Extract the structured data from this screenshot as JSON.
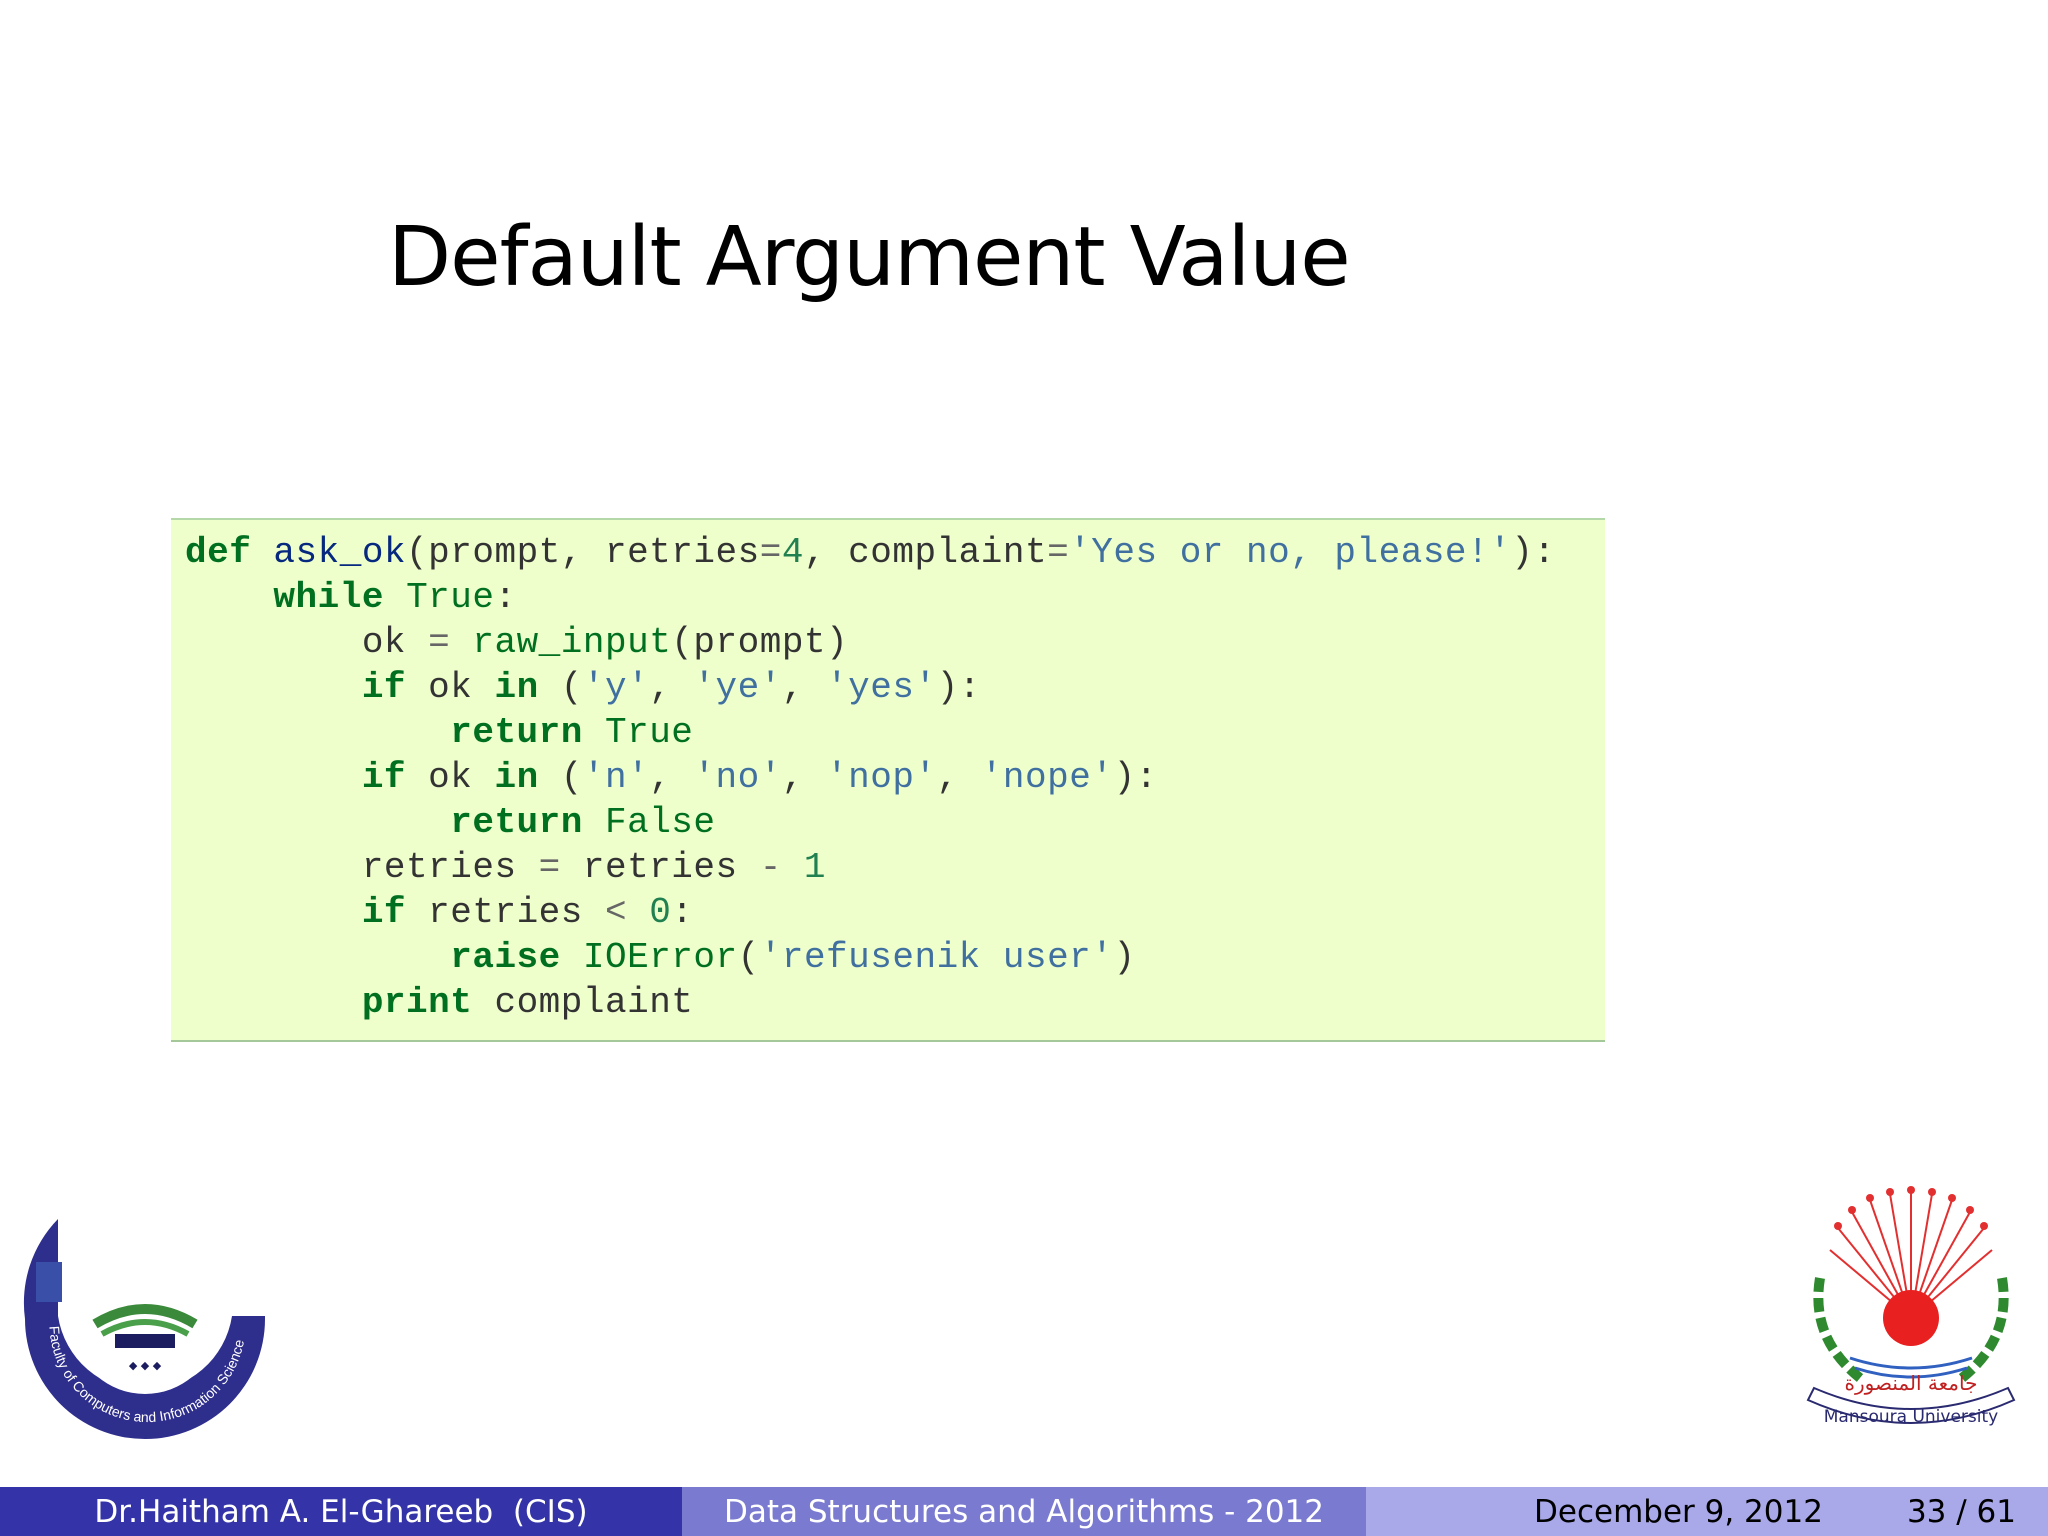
{
  "slide": {
    "title": "Default Argument Value"
  },
  "code": {
    "lines": [
      "def ask_ok(prompt, retries=4, complaint='Yes or no, please!'):",
      "    while True:",
      "        ok = raw_input(prompt)",
      "        if ok in ('y', 'ye', 'yes'):",
      "            return True",
      "        if ok in ('n', 'no', 'nop', 'nope'):",
      "            return False",
      "        retries = retries - 1",
      "        if retries < 0:",
      "            raise IOError('refusenik user')",
      "        print complaint"
    ]
  },
  "footer": {
    "author": "Dr.Haitham A. El-Ghareeb  (CIS)",
    "course": "Data Structures and Algorithms - 2012",
    "date": "December 9, 2012",
    "page": "33 / 61"
  },
  "logos": {
    "left_text": "Faculty of Computers and Information Science",
    "right_text": "Mansoura University"
  },
  "colors": {
    "code_background": "#eeffcc",
    "keyword": "#007020",
    "string": "#4070a0",
    "function_name": "#06287e",
    "footer_left": "#3434a8",
    "footer_mid": "#7a7ad0",
    "footer_right": "#a9a9ea"
  }
}
